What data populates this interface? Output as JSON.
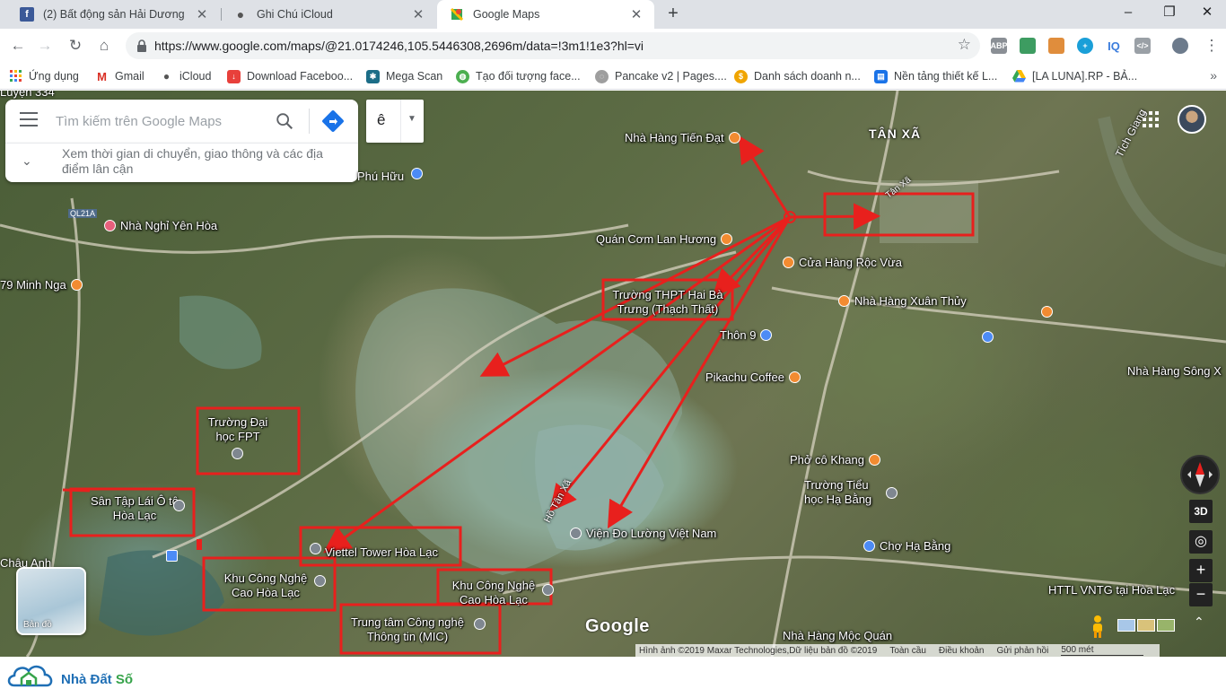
{
  "tabs": [
    {
      "title": "(2) Bất động sản Hải Dương",
      "favicon": "facebook-icon",
      "color": "#3b5998"
    },
    {
      "title": "Ghi Chú iCloud",
      "favicon": "apple-icon",
      "color": "#555555"
    },
    {
      "title": "Google Maps",
      "favicon": "google-maps-icon",
      "color": "#34a853"
    }
  ],
  "toolbar": {
    "url": "https://www.google.com/maps/@21.0174246,105.5446308,2696m/data=!3m1!1e3?hl=vi"
  },
  "extensions": [
    {
      "label": "ABP",
      "color": "#8a8f95"
    },
    {
      "label": "",
      "color": "#3d9c61"
    },
    {
      "label": "",
      "color": "#e08d3c"
    },
    {
      "label": "+",
      "color": "#1a9fd8"
    },
    {
      "label": "IQ",
      "color": "#3b7ddd"
    },
    {
      "label": "</>",
      "color": "#9aa0a6"
    }
  ],
  "bookmarks": [
    {
      "label": "Ứng dụng",
      "icon": "apps-grid-icon",
      "color": "#ea4335"
    },
    {
      "label": "Gmail",
      "icon": "gmail-icon",
      "color": "#d93025"
    },
    {
      "label": "iCloud",
      "icon": "apple-icon",
      "color": "#555555"
    },
    {
      "label": "Download Faceboo...",
      "icon": "download-icon",
      "color": "#e8403b"
    },
    {
      "label": "Mega Scan",
      "icon": "mega-scan-icon",
      "color": "#1b6d87"
    },
    {
      "label": "Tạo đối tượng face...",
      "icon": "globe-icon",
      "color": "#4caf50"
    },
    {
      "label": "Pancake v2 | Pages....",
      "icon": "pancake-icon",
      "color": "#9e9e9e"
    },
    {
      "label": "Danh sách doanh n...",
      "icon": "coin-icon",
      "color": "#f0a500"
    },
    {
      "label": "Nền tảng thiết kế L...",
      "icon": "document-icon",
      "color": "#1a73e8"
    },
    {
      "label": "[LA LUNA].RP - BẢ...",
      "icon": "google-drive-icon",
      "color": "#34a853"
    }
  ],
  "search": {
    "placeholder": "Tìm kiếm trên Google Maps",
    "suggestion": "Xem thời gian di chuyển, giao thông và các địa điểm lân cận",
    "lang": "ê"
  },
  "map": {
    "places": [
      {
        "text": "TÂN XÃ",
        "bold": true
      },
      {
        "text": "Phú Hữu"
      },
      {
        "text": "Luyện 334"
      },
      {
        "text": "Châu Anh"
      },
      {
        "text": "Hồ Tân Xã"
      },
      {
        "text": "Tân Xã"
      },
      {
        "text": "Tích Giang"
      },
      {
        "text": "QL21A"
      }
    ],
    "pois": [
      {
        "text": "Nhà Hàng Tiến Đạt",
        "pin": "orange"
      },
      {
        "text": "Nhà Nghỉ Yên Hòa",
        "pin": "pink"
      },
      {
        "text": "Quán Cơm Lan Hương",
        "pin": "orange"
      },
      {
        "text": "Cửa Hàng Rộc Vừa",
        "pin": "orange"
      },
      {
        "text": "79 Minh Nga",
        "pin": "orange"
      },
      {
        "text": "Nhà Hàng Xuân Thủy",
        "pin": "orange"
      },
      {
        "text": "Thôn 9",
        "pin": "blue"
      },
      {
        "text": "Pikachu Coffee",
        "pin": "orange"
      },
      {
        "text": "Nhà Hàng Sông X",
        "pin": "orange"
      },
      {
        "text": "Phở cô Khang",
        "pin": "orange"
      },
      {
        "text": "Trường Tiểu học Hạ Bằng",
        "pin": "grey"
      },
      {
        "text": "Chợ Hạ Bằng",
        "pin": "blue"
      },
      {
        "text": "Viện Đo Lường Việt Nam",
        "pin": "grey"
      },
      {
        "text": "HTTL VNTG tại Hòa Lạc",
        "pin": "grey"
      },
      {
        "text": "Nhà Hàng Mộc Quán",
        "pin": "orange"
      }
    ],
    "highlights": [
      {
        "text": "Trường THPT Hai Bà Trưng (Thạch Thất)"
      },
      {
        "text": "Trường Đại học FPT"
      },
      {
        "text": "Sân Tập Lái Ô tô Hòa Lạc"
      },
      {
        "text": "Viettel Tower Hòa Lạc"
      },
      {
        "text": "Khu Công Nghệ Cao Hòa Lạc"
      },
      {
        "text": "Khu Công Nghệ Cao Hòa Lạc"
      },
      {
        "text": "Trung tâm Công nghệ Thông tin (MIC)"
      }
    ],
    "minimap_label": "Bản đồ",
    "google_logo": "Google",
    "footer": [
      "Hình ảnh ©2019 Maxar Technologies,Dữ liệu bản đồ ©2019",
      "Toàn cầu",
      "Điều khoản",
      "Gửi phản hồi",
      "500 mét"
    ],
    "controls": {
      "three_d": "3D",
      "zoom_in": "+",
      "zoom_out": "−"
    }
  },
  "brand": {
    "name_a": "Nhà Đất ",
    "name_b": "Số"
  },
  "colors": {
    "annotation": "#e8201d",
    "accent": "#1a73e8"
  }
}
